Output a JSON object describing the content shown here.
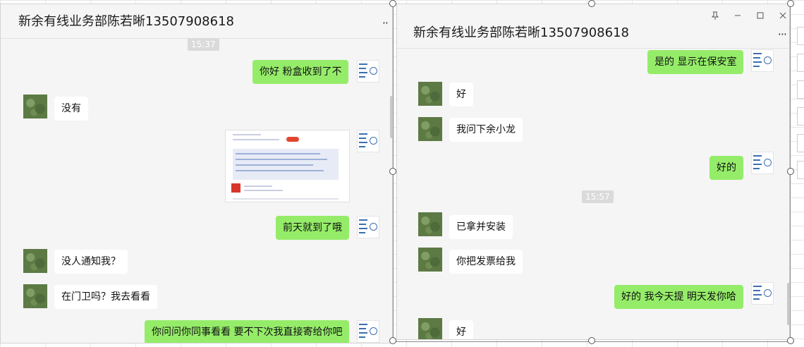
{
  "left_window": {
    "title": "新余有线业务部陈若晰13507908618",
    "timestamp": "15:37",
    "messages": [
      {
        "from": "me",
        "text": "你好 粉盒收到了不"
      },
      {
        "from": "other",
        "text": "没有"
      },
      {
        "from": "me",
        "type": "image"
      },
      {
        "from": "me",
        "text": "前天就到了哦"
      },
      {
        "from": "other",
        "text": "没人通知我？"
      },
      {
        "from": "other",
        "text": "在门卫吗？我去看看"
      },
      {
        "from": "me",
        "text": "你问问你同事看看 要不下次我直接寄给你吧"
      }
    ]
  },
  "right_window": {
    "title": "新余有线业务部陈若晰13507908618",
    "timestamp": "15:57",
    "window_controls": {
      "pin": "pin-icon",
      "minimize": "minimize-icon",
      "maximize": "maximize-icon",
      "close": "close-icon"
    },
    "messages": [
      {
        "from": "me",
        "text": "是的 显示在保安室"
      },
      {
        "from": "other",
        "text": "好"
      },
      {
        "from": "other",
        "text": "我问下余小龙"
      },
      {
        "from": "me",
        "text": "好的"
      },
      {
        "from": "other",
        "text": "已拿并安装"
      },
      {
        "from": "other",
        "text": "你把发票给我"
      },
      {
        "from": "me",
        "text": "好的 我今天提 明天发你哈"
      },
      {
        "from": "other",
        "text": "好"
      }
    ]
  },
  "colors": {
    "my_bubble": "#95ec69",
    "other_bubble": "#ffffff",
    "window_bg": "#f5f5f5"
  }
}
